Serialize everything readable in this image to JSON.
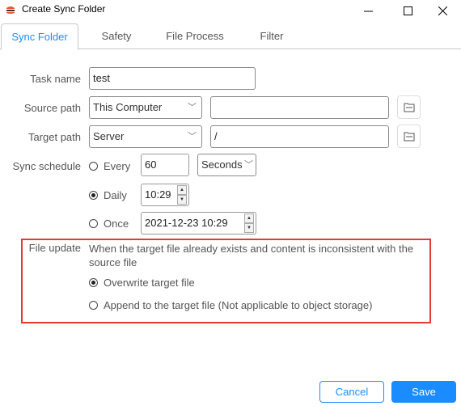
{
  "window": {
    "title": "Create Sync Folder",
    "controls": {
      "minimize": "—",
      "maximize": "☐",
      "close": "✕"
    }
  },
  "tabs": [
    {
      "label": "Sync Folder",
      "active": true
    },
    {
      "label": "Safety",
      "active": false
    },
    {
      "label": "File Process",
      "active": false
    },
    {
      "label": "Filter",
      "active": false
    }
  ],
  "form": {
    "task_name": {
      "label": "Task name",
      "value": "test"
    },
    "source_path": {
      "label": "Source path",
      "type": "This Computer",
      "value": ""
    },
    "target_path": {
      "label": "Target path",
      "type": "Server",
      "value": "/"
    },
    "sync_schedule": {
      "label": "Sync schedule",
      "every": {
        "label": "Every",
        "value": "60",
        "unit": "Seconds",
        "selected": false
      },
      "daily": {
        "label": "Daily",
        "value": "10:29",
        "selected": true
      },
      "once": {
        "label": "Once",
        "value": "2021-12-23 10:29",
        "selected": false
      }
    },
    "file_update": {
      "label": "File update",
      "description": "When the target file already exists and content is inconsistent with the source file",
      "options": [
        {
          "label": "Overwrite target file",
          "selected": true
        },
        {
          "label": "Append to the target file (Not applicable to object storage)",
          "selected": false
        }
      ]
    }
  },
  "footer": {
    "cancel_label": "Cancel",
    "save_label": "Save"
  },
  "colors": {
    "accent": "#1a8cff",
    "highlight_border": "#e53935"
  }
}
